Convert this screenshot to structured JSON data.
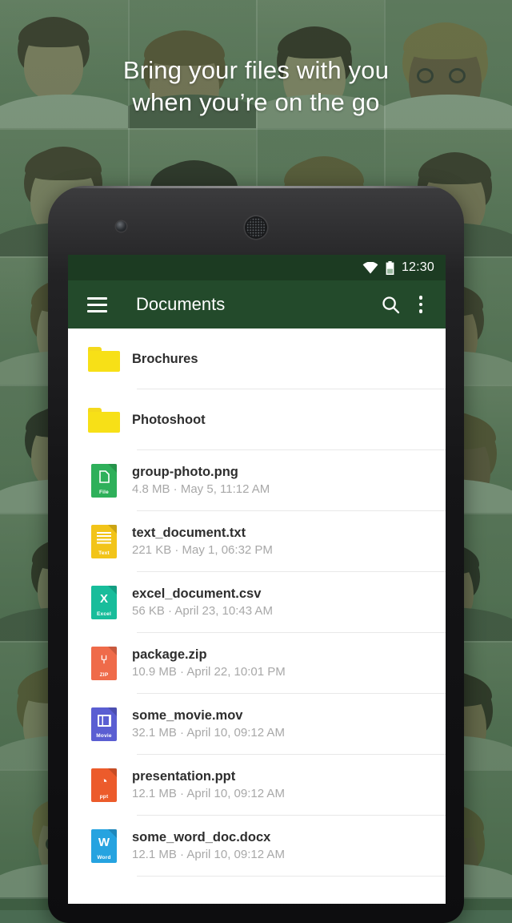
{
  "promo": {
    "headline_line1": "Bring your files with you",
    "headline_line2": "when you’re on the go"
  },
  "device": {
    "front_camera": "front-camera",
    "earpiece": "earpiece-speaker"
  },
  "statusbar": {
    "wifi_icon": "wifi-icon",
    "battery_icon": "battery-icon",
    "time": "12:30"
  },
  "appbar": {
    "menu_icon": "hamburger-menu-icon",
    "title": "Documents",
    "search_icon": "search-icon",
    "overflow_icon": "overflow-menu-icon"
  },
  "colors": {
    "statusbar_bg": "#1c3b22",
    "appbar_bg": "#234a2b",
    "folder_yellow": "#f7e017",
    "divider": "#e8e8e8",
    "filename": "#2e2e2e",
    "meta": "#a8a8a8"
  },
  "filelist": {
    "items": [
      {
        "type": "folder",
        "name": "Brochures",
        "icon": "folder-icon",
        "meta": "",
        "tag": "",
        "glyph": "",
        "color": "#f7e017"
      },
      {
        "type": "folder",
        "name": "Photoshoot",
        "icon": "folder-icon",
        "meta": "",
        "tag": "",
        "glyph": "",
        "color": "#f7e017"
      },
      {
        "type": "file",
        "name": "group-photo.png",
        "meta": "4.8 MB · May 5, 11:12 AM",
        "icon": "file-icon-generic",
        "tag": "File",
        "glyph": "⬜",
        "color": "#2eb05a"
      },
      {
        "type": "file",
        "name": "text_document.txt",
        "meta": "221 KB · May 1, 06:32 PM",
        "icon": "file-icon-text",
        "tag": "Text",
        "glyph": "",
        "color": "#f2c419"
      },
      {
        "type": "file",
        "name": "excel_document.csv",
        "meta": "56 KB · April 23, 10:43 AM",
        "icon": "file-icon-excel",
        "tag": "Excel",
        "glyph": "X",
        "color": "#18bd9b"
      },
      {
        "type": "file",
        "name": "package.zip",
        "meta": "10.9 MB · April 22, 10:01 PM",
        "icon": "file-icon-zip",
        "tag": "ZIP",
        "glyph": "⑂",
        "color": "#ef6b4a"
      },
      {
        "type": "file",
        "name": "some_movie.mov",
        "meta": "32.1 MB · April 10, 09:12 AM",
        "icon": "file-icon-movie",
        "tag": "Movie",
        "glyph": "",
        "color": "#5a5ed2"
      },
      {
        "type": "file",
        "name": "presentation.ppt",
        "meta": "12.1 MB · April 10, 09:12 AM",
        "icon": "file-icon-ppt",
        "tag": "ppt",
        "glyph": "◔",
        "color": "#ec5b2b"
      },
      {
        "type": "file",
        "name": "some_word_doc.docx",
        "meta": "12.1 MB · April 10, 09:12 AM",
        "icon": "file-icon-word",
        "tag": "Word",
        "glyph": "W",
        "color": "#26a3e0"
      }
    ]
  }
}
